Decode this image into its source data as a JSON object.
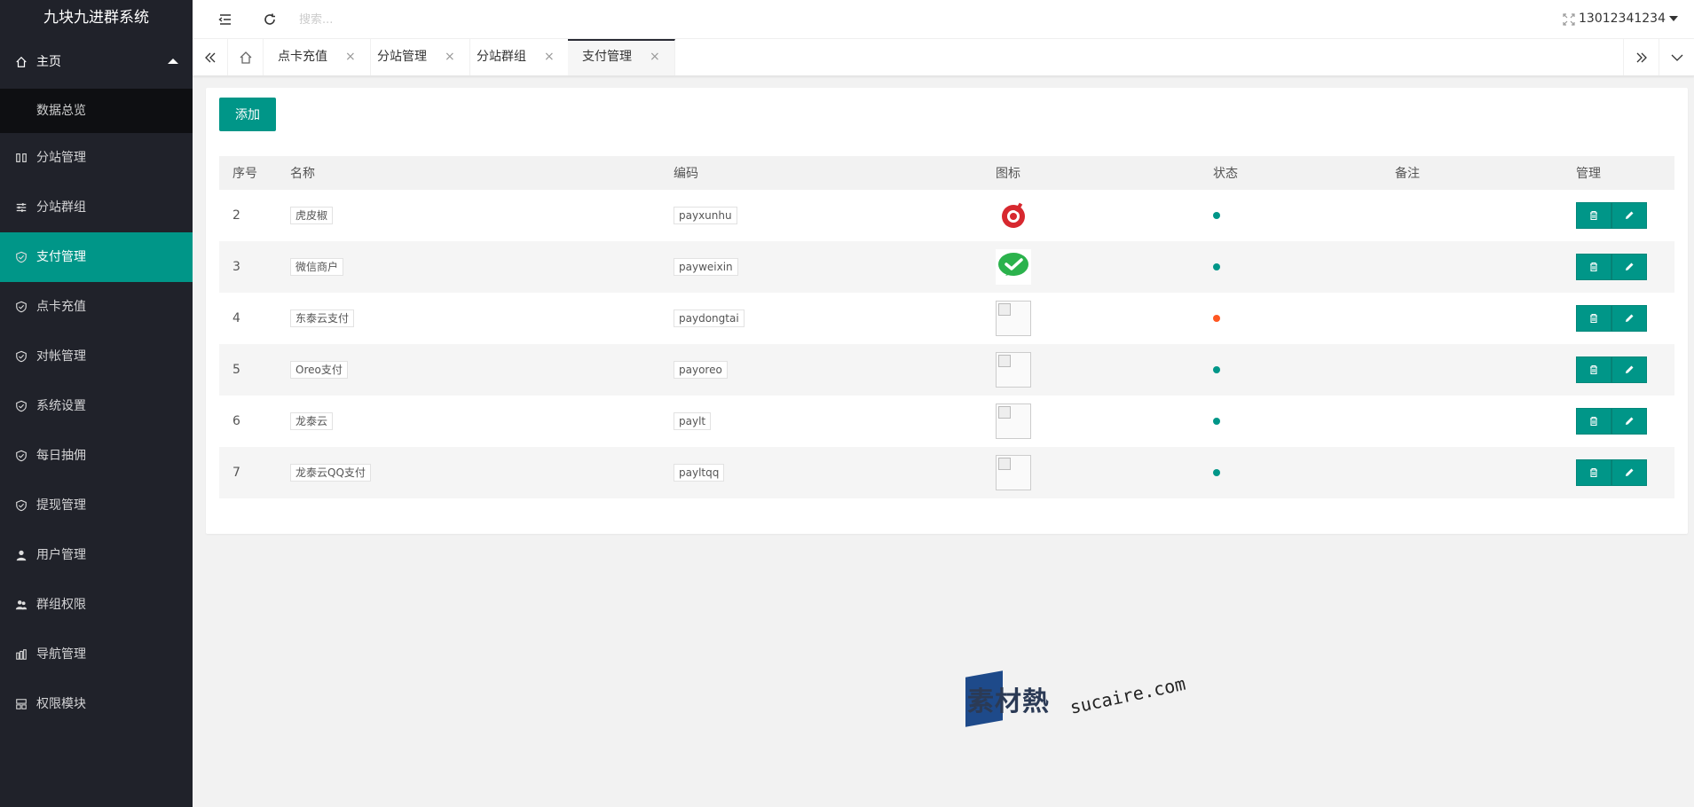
{
  "app": {
    "title": "九块九进群系统"
  },
  "sidebar": {
    "home": {
      "label": "主页"
    },
    "home_sub": {
      "label": "数据总览"
    },
    "items": [
      {
        "label": "分站管理",
        "icon": "columns-icon"
      },
      {
        "label": "分站群组",
        "icon": "sliders-icon"
      },
      {
        "label": "支付管理",
        "icon": "shield-check-icon",
        "active": true
      },
      {
        "label": "点卡充值",
        "icon": "shield-check-icon"
      },
      {
        "label": "对帐管理",
        "icon": "shield-check-icon"
      },
      {
        "label": "系统设置",
        "icon": "shield-check-icon"
      },
      {
        "label": "每日抽佣",
        "icon": "shield-check-icon"
      },
      {
        "label": "提现管理",
        "icon": "shield-check-icon"
      },
      {
        "label": "用户管理",
        "icon": "user-icon"
      },
      {
        "label": "群组权限",
        "icon": "users-icon"
      },
      {
        "label": "导航管理",
        "icon": "nav-icon"
      },
      {
        "label": "权限模块",
        "icon": "module-icon"
      }
    ]
  },
  "header": {
    "search_placeholder": "搜索...",
    "username": "13012341234"
  },
  "tabs": [
    {
      "label": "点卡充值"
    },
    {
      "label": "分站管理"
    },
    {
      "label": "分站群组"
    },
    {
      "label": "支付管理",
      "active": true
    }
  ],
  "tab_close_glyph": "×",
  "main": {
    "add_label": "添加",
    "columns": [
      "序号",
      "名称",
      "编码",
      "图标",
      "状态",
      "备注",
      "管理"
    ],
    "rows": [
      {
        "id": "2",
        "name": "虎皮椒",
        "code": "payxunhu",
        "icon": "xunhu-logo",
        "status": "on",
        "remark": ""
      },
      {
        "id": "3",
        "name": "微信商户",
        "code": "payweixin",
        "icon": "wechat-logo",
        "status": "on",
        "remark": ""
      },
      {
        "id": "4",
        "name": "东泰云支付",
        "code": "paydongtai",
        "icon": "broken-image",
        "status": "off",
        "remark": ""
      },
      {
        "id": "5",
        "name": "Oreo支付",
        "code": "payoreo",
        "icon": "broken-image",
        "status": "on",
        "remark": ""
      },
      {
        "id": "6",
        "name": "龙泰云",
        "code": "paylt",
        "icon": "broken-image",
        "status": "on",
        "remark": ""
      },
      {
        "id": "7",
        "name": "龙泰云QQ支付",
        "code": "payltqq",
        "icon": "broken-image",
        "status": "on",
        "remark": ""
      }
    ]
  },
  "colors": {
    "accent": "#009688",
    "sidebar_bg": "#20222a",
    "status_on": "#009688",
    "status_off": "#ff5722"
  },
  "watermark": {
    "cn": "素材熱",
    "en": "sucaire.com"
  }
}
